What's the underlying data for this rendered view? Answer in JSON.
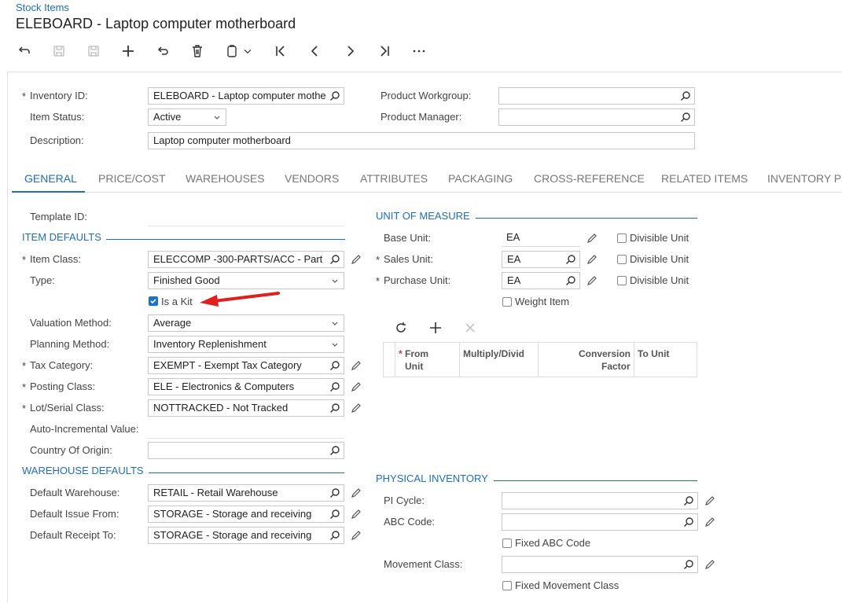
{
  "header": {
    "breadcrumb": "Stock Items",
    "title": "ELEBOARD - Laptop computer motherboard"
  },
  "top": {
    "inventory_id_label": "Inventory ID:",
    "inventory_id_value": "ELEBOARD - Laptop computer mothe",
    "item_status_label": "Item Status:",
    "item_status_value": "Active",
    "description_label": "Description:",
    "description_value": "Laptop computer motherboard",
    "product_workgroup_label": "Product Workgroup:",
    "product_workgroup_value": "",
    "product_manager_label": "Product Manager:",
    "product_manager_value": ""
  },
  "tabs": [
    "GENERAL",
    "PRICE/COST",
    "WAREHOUSES",
    "VENDORS",
    "ATTRIBUTES",
    "PACKAGING",
    "CROSS-REFERENCE",
    "RELATED ITEMS",
    "INVENTORY PL"
  ],
  "general": {
    "template_id_label": "Template ID:",
    "item_defaults_title": "ITEM DEFAULTS",
    "item_class_label": "Item Class:",
    "item_class_value": "ELECCOMP  -300-PARTS/ACC - Part",
    "type_label": "Type:",
    "type_value": "Finished Good",
    "is_kit_label": "Is a Kit",
    "is_kit_checked": true,
    "valuation_label": "Valuation Method:",
    "valuation_value": "Average",
    "planning_label": "Planning Method:",
    "planning_value": "Inventory Replenishment",
    "tax_label": "Tax Category:",
    "tax_value": "EXEMPT - Exempt Tax Category",
    "posting_label": "Posting Class:",
    "posting_value": "ELE - Electronics & Computers",
    "lot_label": "Lot/Serial Class:",
    "lot_value": "NOTTRACKED - Not Tracked",
    "auto_inc_label": "Auto-Incremental Value:",
    "country_label": "Country Of Origin:",
    "country_value": "",
    "warehouse_defaults_title": "WAREHOUSE DEFAULTS",
    "def_wh_label": "Default Warehouse:",
    "def_wh_value": "RETAIL - Retail Warehouse",
    "def_issue_label": "Default Issue From:",
    "def_issue_value": "STORAGE - Storage and receiving",
    "def_receipt_label": "Default Receipt To:",
    "def_receipt_value": "STORAGE - Storage and receiving"
  },
  "uom": {
    "title": "UNIT OF MEASURE",
    "base_label": "Base Unit:",
    "base_value": "EA",
    "sales_label": "Sales Unit:",
    "sales_value": "EA",
    "purchase_label": "Purchase Unit:",
    "purchase_value": "EA",
    "divisible_label": "Divisible Unit",
    "weight_item_label": "Weight Item",
    "grid_from": "From Unit",
    "grid_from_l1": "From",
    "grid_from_l2": "Unit",
    "grid_mult": "Multiply/Divid",
    "grid_conv_l1": "Conversion",
    "grid_conv_l2": "Factor",
    "grid_to": "To Unit"
  },
  "physical": {
    "title": "PHYSICAL INVENTORY",
    "pi_cycle_label": "PI Cycle:",
    "pi_cycle_value": "",
    "abc_label": "ABC Code:",
    "abc_value": "",
    "fixed_abc_label": "Fixed ABC Code",
    "movement_label": "Movement Class:",
    "movement_value": "",
    "fixed_movement_label": "Fixed Movement Class"
  },
  "accent_color": "#1d6fb8",
  "arrow_color": "#e02020"
}
